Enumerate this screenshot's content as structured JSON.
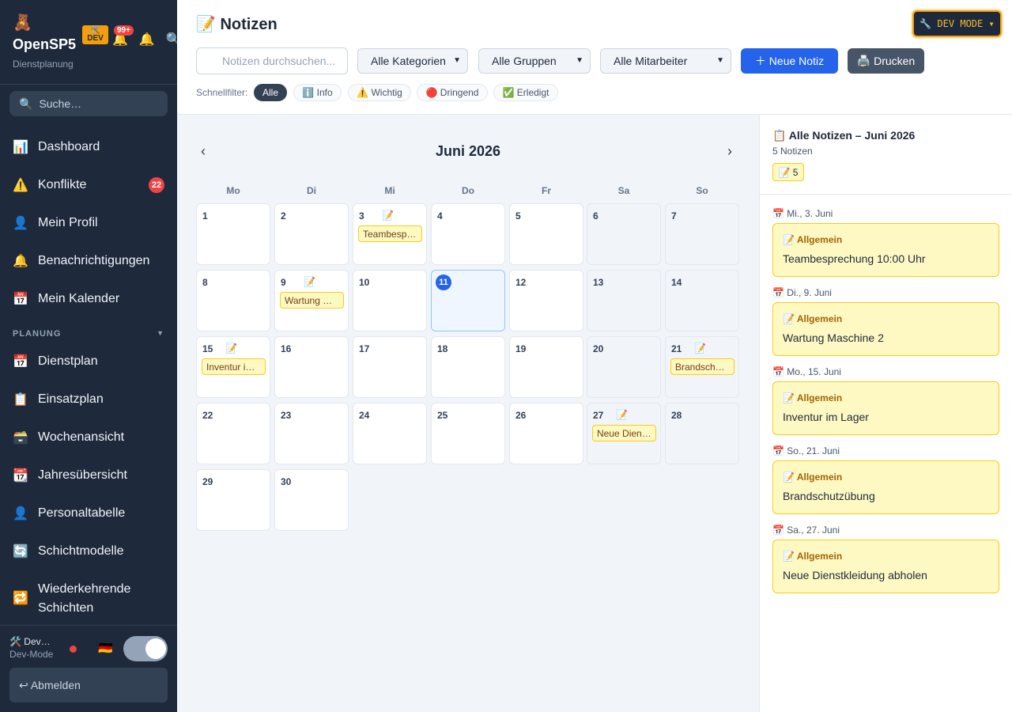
{
  "app": {
    "logo_emoji": "🧸",
    "name": "OpenSP5",
    "badge_icon": "🛠️",
    "badge": "DEV",
    "subtitle": "Dienstplanung",
    "notif_count": "99+"
  },
  "sidebar": {
    "search_placeholder": "Suche…",
    "items": [
      {
        "icon": "📊",
        "label": "Dashboard"
      },
      {
        "icon": "⚠️",
        "label": "Konflikte",
        "badge": "22"
      },
      {
        "icon": "👤",
        "label": "Mein Profil"
      },
      {
        "icon": "🔔",
        "label": "Benachrichtigungen"
      },
      {
        "icon": "📅",
        "label": "Mein Kalender"
      }
    ],
    "section": "PLANUNG",
    "planung_items": [
      {
        "icon": "📅",
        "label": "Dienstplan"
      },
      {
        "icon": "📋",
        "label": "Einsatzplan"
      },
      {
        "icon": "🗃️",
        "label": "Wochenansicht"
      },
      {
        "icon": "📆",
        "label": "Jahresübersicht"
      },
      {
        "icon": "👤",
        "label": "Personaltabelle"
      },
      {
        "icon": "🔄",
        "label": "Schichtmodelle"
      },
      {
        "icon": "🔁",
        "label": "Wiederkehrende Schichten"
      }
    ],
    "user": {
      "name": "🛠️ Dev…",
      "role": "Dev-Mode",
      "flag": "🇩🇪"
    },
    "logout": "↩ Abmelden"
  },
  "header": {
    "title_icon": "📝",
    "title": "Notizen",
    "devmode": "🔧 DEV MODE ▾",
    "search_placeholder": "Notizen durchsuchen...",
    "filters": {
      "kategorie": "Alle Kategorien",
      "gruppe": "Alle Gruppen",
      "mitarbeiter": "Alle Mitarbeiter"
    },
    "new_note": "＋  Neue Notiz",
    "print": "🖨️ Drucken",
    "quickfilter_label": "Schnellfilter:",
    "quickfilters": [
      "Alle",
      "ℹ️ Info",
      "⚠️ Wichtig",
      "🔴 Dringend",
      "✅ Erledigt"
    ]
  },
  "calendar": {
    "month": "Juni 2026",
    "prev": "‹",
    "next": "›",
    "weekdays": [
      "Mo",
      "Di",
      "Mi",
      "Do",
      "Fr",
      "Sa",
      "So"
    ],
    "note_icon": "📝",
    "today": "11",
    "notes": {
      "3": "Teambesprechung 10:00 Uhr",
      "9": "Wartung Maschine 2",
      "15": "Inventur im Lager",
      "21": "Brandschutzübung",
      "27": "Neue Dienstkleidung abholen"
    }
  },
  "panel": {
    "title": "📋 Alle Notizen – Juni 2026",
    "count": "5 Notizen",
    "chip": "📝 5",
    "entries": [
      {
        "date": "📅 Mi., 3. Juni",
        "category": "📝  Allgemein",
        "text": "Teambesprechung 10:00 Uhr"
      },
      {
        "date": "📅 Di., 9. Juni",
        "category": "📝  Allgemein",
        "text": "Wartung Maschine 2"
      },
      {
        "date": "📅 Mo., 15. Juni",
        "category": "📝  Allgemein",
        "text": "Inventur im Lager"
      },
      {
        "date": "📅 So., 21. Juni",
        "category": "📝  Allgemein",
        "text": "Brandschutzübung"
      },
      {
        "date": "📅 Sa., 27. Juni",
        "category": "📝  Allgemein",
        "text": "Neue Dienstkleidung abholen"
      }
    ]
  },
  "colors": {
    "sidebar": "#1e293b",
    "accent": "#2563eb",
    "note_bg": "#fef9c3",
    "note_border": "#facc15",
    "danger": "#ef4444",
    "devmode": "#f59e0b"
  }
}
